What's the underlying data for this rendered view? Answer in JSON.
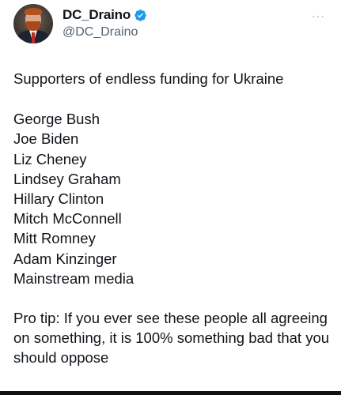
{
  "author": {
    "display_name": "DC_Draino",
    "handle": "@DC_Draino",
    "verified": true,
    "verified_icon": "verified-badge-icon",
    "avatar": "profile-photo"
  },
  "menu": {
    "icon": "more-options-icon",
    "glyph": "···"
  },
  "tweet": {
    "intro": "Supporters of endless funding for Ukraine",
    "people": [
      "George Bush",
      "Joe Biden",
      "Liz Cheney",
      "Lindsey Graham",
      "Hillary Clinton",
      "Mitch McConnell",
      "Mitt Romney",
      "Adam Kinzinger",
      "Mainstream media"
    ],
    "tip": "Pro tip: If you ever see these people all agreeing on something, it is 100% something bad that you should oppose"
  },
  "colors": {
    "text": "#0f1419",
    "secondary": "#536471",
    "verified": "#1d9bf0"
  }
}
